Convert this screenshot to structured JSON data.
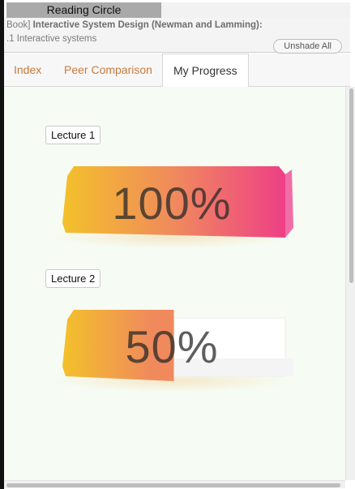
{
  "window": {
    "title": "Reading Circle"
  },
  "header": {
    "book_prefix": "Book] ",
    "book_title": "Interactive System Design (Newman and Lamming):",
    "section": ".1 Interactive systems",
    "unshade_label": "Unshade All"
  },
  "tabs": [
    {
      "label": "Index",
      "active": false
    },
    {
      "label": "Peer Comparison",
      "active": false
    },
    {
      "label": "My Progress",
      "active": true
    }
  ],
  "progress": [
    {
      "label": "Lecture 1",
      "percent_text": "100%",
      "value": 1.0
    },
    {
      "label": "Lecture 2",
      "percent_text": "50%",
      "value": 0.5
    }
  ],
  "colors": {
    "gradient_start": "#f3c12a",
    "gradient_mid": "#f08a5d",
    "gradient_end": "#ee3f86",
    "tab_link": "#c97a3c",
    "content_bg": "#f6fcf4"
  }
}
